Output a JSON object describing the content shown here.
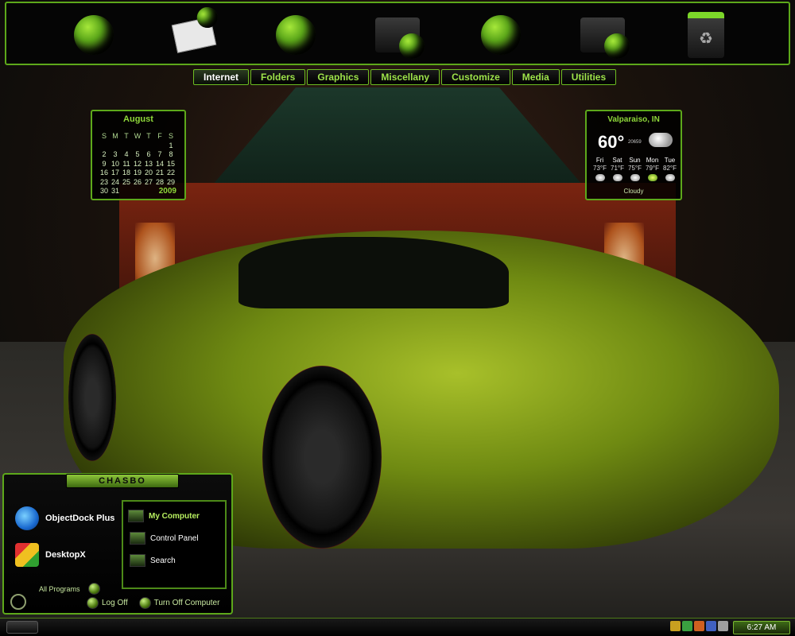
{
  "dock": {
    "items": [
      {
        "icon": "globe-icon"
      },
      {
        "icon": "mail-globe-icon"
      },
      {
        "icon": "globe-icon"
      },
      {
        "icon": "folder-globe-icon"
      },
      {
        "icon": "globe-icon"
      },
      {
        "icon": "folder-globe-icon"
      },
      {
        "icon": "recycle-bin-icon"
      }
    ]
  },
  "menu": {
    "items": [
      "Internet",
      "Folders",
      "Graphics",
      "Miscellany",
      "Customize",
      "Media",
      "Utilities"
    ]
  },
  "calendar": {
    "month": "August",
    "year": "2009",
    "day_headers": [
      "S",
      "M",
      "T",
      "W",
      "T",
      "F",
      "S"
    ],
    "cells": [
      "",
      "",
      "",
      "",
      "",
      "",
      "1",
      "2",
      "3",
      "4",
      "5",
      "6",
      "7",
      "8",
      "9",
      "10",
      "11",
      "12",
      "13",
      "14",
      "15",
      "16",
      "17",
      "18",
      "19",
      "20",
      "21",
      "22",
      "23",
      "24",
      "25",
      "26",
      "27",
      "28",
      "29",
      "30",
      "31",
      "",
      "",
      "",
      "",
      ""
    ]
  },
  "weather": {
    "location": "Valparaiso, IN",
    "temp": "60°",
    "small_text": "20659",
    "condition": "Cloudy",
    "days": [
      {
        "name": "Fri",
        "high": "73°F",
        "icon": "cloud"
      },
      {
        "name": "Sat",
        "high": "71°F",
        "icon": "cloud"
      },
      {
        "name": "Sun",
        "high": "75°F",
        "icon": "cloud"
      },
      {
        "name": "Mon",
        "high": "79°F",
        "icon": "sun"
      },
      {
        "name": "Tue",
        "high": "82°F",
        "icon": "cloud"
      }
    ]
  },
  "start_panel": {
    "title": "CHASBO",
    "pinned": [
      {
        "label": "ObjectDock Plus"
      },
      {
        "label": "DesktopX"
      }
    ],
    "places": [
      {
        "label": "My Computer"
      },
      {
        "label": "Control Panel"
      },
      {
        "label": "Search"
      }
    ],
    "all_programs": "All Programs",
    "log_off": "Log Off",
    "turn_off": "Turn Off Computer"
  },
  "taskbar": {
    "clock": "6:27 AM"
  },
  "colors": {
    "accent": "#5da81a",
    "accent_text": "#9ee34a"
  }
}
